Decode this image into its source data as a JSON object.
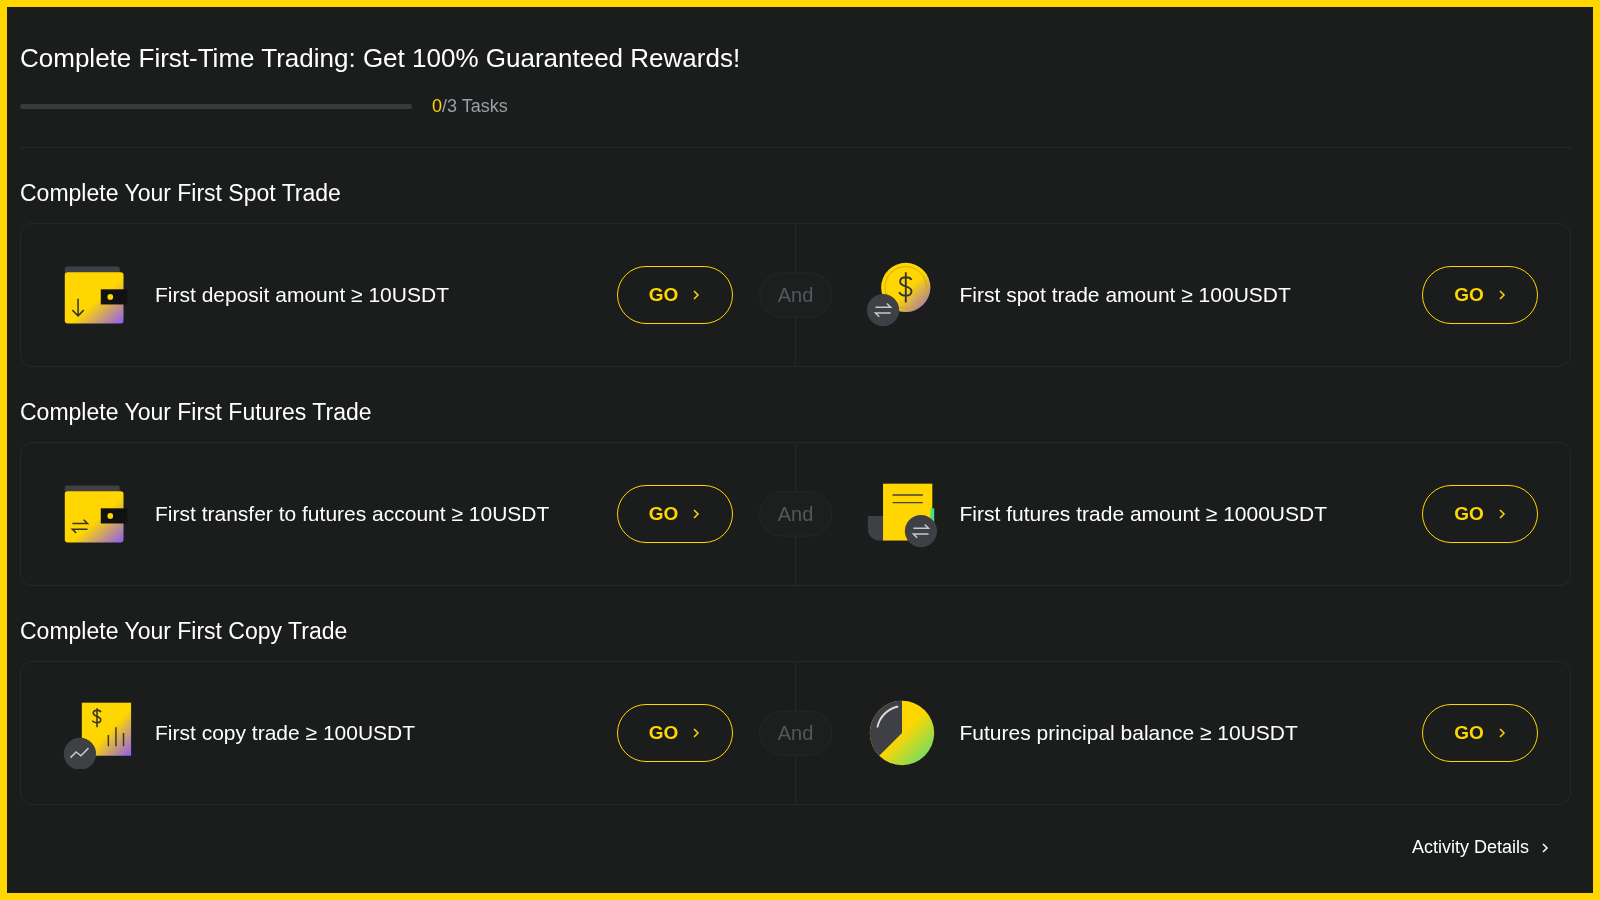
{
  "title": "Complete First-Time Trading: Get 100% Guaranteed Rewards!",
  "progress": {
    "level": 0,
    "done": "0",
    "label": "/3 Tasks"
  },
  "sections": [
    {
      "title": "Complete Your First Spot Trade",
      "joiner": "And",
      "tasks": [
        {
          "text": "First deposit amount ≥ 10USDT",
          "button": "GO"
        },
        {
          "text": "First spot trade amount ≥ 100USDT",
          "button": "GO"
        }
      ]
    },
    {
      "title": "Complete Your First Futures Trade",
      "joiner": "And",
      "tasks": [
        {
          "text": "First transfer to futures account ≥ 10USDT",
          "button": "GO"
        },
        {
          "text": "First futures trade amount ≥ 1000USDT",
          "button": "GO"
        }
      ]
    },
    {
      "title": "Complete Your First Copy Trade",
      "joiner": "And",
      "tasks": [
        {
          "text": "First copy trade ≥ 100USDT",
          "button": "GO"
        },
        {
          "text": "Futures principal balance ≥ 10USDT",
          "button": "GO"
        }
      ]
    }
  ],
  "footer_link": "Activity Details"
}
